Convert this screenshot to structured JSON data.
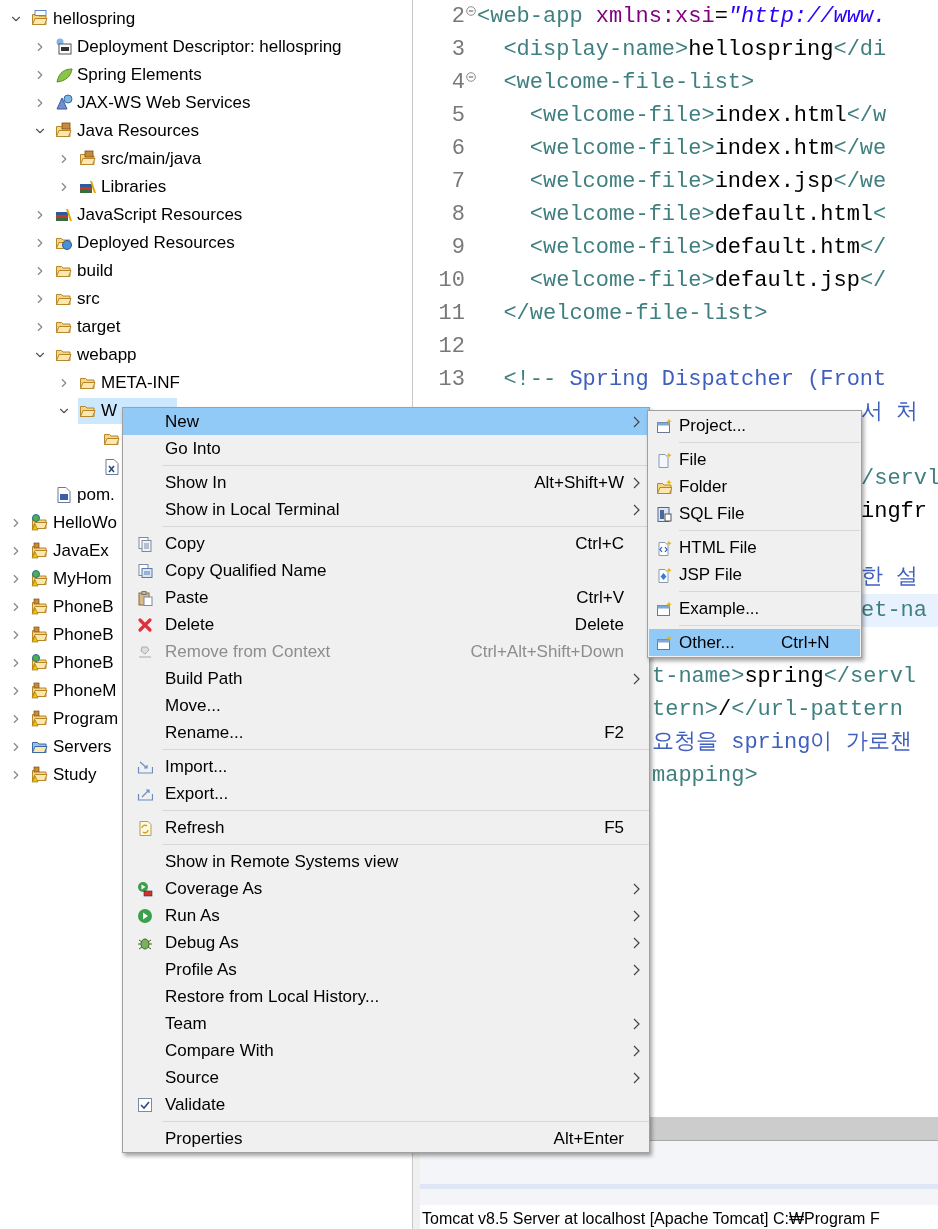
{
  "project_explorer": {
    "tree": [
      {
        "label": "hellospring",
        "kind": "maven-project",
        "expanded": true,
        "selected": false,
        "children": [
          {
            "label": "Deployment Descriptor: hellospring",
            "kind": "descriptor",
            "expanded": false,
            "selected": false
          },
          {
            "label": "Spring Elements",
            "kind": "leaf",
            "expanded": false,
            "selected": false
          },
          {
            "label": "JAX-WS Web Services",
            "kind": "webservice",
            "expanded": false,
            "selected": false
          },
          {
            "label": "Java Resources",
            "kind": "java-folder",
            "expanded": true,
            "selected": false,
            "children": [
              {
                "label": "src/main/java",
                "kind": "package-folder",
                "expanded": false,
                "selected": false
              },
              {
                "label": "Libraries",
                "kind": "books",
                "expanded": false,
                "selected": false
              }
            ]
          },
          {
            "label": "JavaScript Resources",
            "kind": "books",
            "expanded": false,
            "selected": false
          },
          {
            "label": "Deployed Resources",
            "kind": "globe-folder",
            "expanded": false,
            "selected": false
          },
          {
            "label": "build",
            "kind": "folder",
            "expanded": false,
            "selected": false
          },
          {
            "label": "src",
            "kind": "folder",
            "expanded": false,
            "selected": false
          },
          {
            "label": "target",
            "kind": "folder",
            "expanded": false,
            "selected": false
          },
          {
            "label": "webapp",
            "kind": "folder",
            "expanded": true,
            "selected": false,
            "children": [
              {
                "label": "META-INF",
                "kind": "folder",
                "expanded": false,
                "selected": false
              },
              {
                "label": "W",
                "kind": "folder",
                "expanded": true,
                "selected": true,
                "children": [
                  {
                    "kind": "folder",
                    "selected": false
                  },
                  {
                    "kind": "xml-file",
                    "selected": false
                  }
                ]
              }
            ]
          },
          {
            "label": "pom.",
            "kind": "maven-file",
            "selected": false
          }
        ]
      },
      {
        "label": "HelloWo",
        "kind": "globe-project",
        "expanded": false,
        "selected": false
      },
      {
        "label": "JavaEx",
        "kind": "project",
        "expanded": false,
        "selected": false
      },
      {
        "label": "MyHom",
        "kind": "globe-project",
        "expanded": false,
        "selected": false
      },
      {
        "label": "PhoneB",
        "kind": "project",
        "expanded": false,
        "selected": false
      },
      {
        "label": "PhoneB",
        "kind": "project",
        "expanded": false,
        "selected": false
      },
      {
        "label": "PhoneB",
        "kind": "globe-project",
        "expanded": false,
        "selected": false
      },
      {
        "label": "PhoneM",
        "kind": "project",
        "expanded": false,
        "selected": false
      },
      {
        "label": "Program",
        "kind": "project",
        "expanded": false,
        "selected": false
      },
      {
        "label": "Servers",
        "kind": "server-folder",
        "expanded": false,
        "selected": false
      },
      {
        "label": "Study",
        "kind": "project",
        "expanded": false,
        "selected": false
      }
    ]
  },
  "editor": {
    "lines": [
      {
        "kind": "full",
        "number": "2",
        "fold": true,
        "current": false,
        "segments": [
          {
            "kind": "tag",
            "text": "<web-app"
          },
          {
            "kind": "attr",
            "text": " xmlns:xsi"
          },
          {
            "kind": "text",
            "text": "="
          },
          {
            "kind": "value",
            "text": "\"http://www."
          }
        ]
      },
      {
        "kind": "full",
        "number": "3",
        "fold": false,
        "current": false,
        "segments": [
          {
            "kind": "tag",
            "text": "  <display-name>"
          },
          {
            "kind": "text",
            "text": "hellospring"
          },
          {
            "kind": "tag",
            "text": "</di"
          }
        ]
      },
      {
        "kind": "full",
        "number": "4",
        "fold": true,
        "current": false,
        "segments": [
          {
            "kind": "tag",
            "text": "  <welcome-file-list>"
          }
        ]
      },
      {
        "kind": "full",
        "number": "5",
        "fold": false,
        "current": false,
        "segments": [
          {
            "kind": "tag",
            "text": "    <welcome-file>"
          },
          {
            "kind": "text",
            "text": "index.html"
          },
          {
            "kind": "tag",
            "text": "</w"
          }
        ]
      },
      {
        "kind": "full",
        "number": "6",
        "fold": false,
        "current": false,
        "segments": [
          {
            "kind": "tag",
            "text": "    <welcome-file>"
          },
          {
            "kind": "text",
            "text": "index.htm"
          },
          {
            "kind": "tag",
            "text": "</we"
          }
        ]
      },
      {
        "kind": "full",
        "number": "7",
        "fold": false,
        "current": false,
        "segments": [
          {
            "kind": "tag",
            "text": "    <welcome-file>"
          },
          {
            "kind": "text",
            "text": "index.jsp"
          },
          {
            "kind": "tag",
            "text": "</we"
          }
        ]
      },
      {
        "kind": "full",
        "number": "8",
        "fold": false,
        "current": false,
        "segments": [
          {
            "kind": "tag",
            "text": "    <welcome-file>"
          },
          {
            "kind": "text",
            "text": "default.html"
          },
          {
            "kind": "tag",
            "text": "<"
          }
        ]
      },
      {
        "kind": "full",
        "number": "9",
        "fold": false,
        "current": false,
        "segments": [
          {
            "kind": "tag",
            "text": "    <welcome-file>"
          },
          {
            "kind": "text",
            "text": "default.htm"
          },
          {
            "kind": "tag",
            "text": "</"
          }
        ]
      },
      {
        "kind": "full",
        "number": "10",
        "fold": false,
        "current": false,
        "segments": [
          {
            "kind": "tag",
            "text": "    <welcome-file>"
          },
          {
            "kind": "text",
            "text": "default.jsp"
          },
          {
            "kind": "tag",
            "text": "</"
          }
        ]
      },
      {
        "kind": "full",
        "number": "11",
        "fold": false,
        "current": false,
        "segments": [
          {
            "kind": "tag",
            "text": "  </welcome-file-list>"
          }
        ]
      },
      {
        "kind": "full",
        "number": "12",
        "fold": false,
        "current": false
      },
      {
        "kind": "full",
        "number": "13",
        "fold": false,
        "current": false,
        "segments": [
          {
            "kind": "tag",
            "text": "  <!--"
          },
          {
            "kind": "comment",
            "text": " Spring Dispatcher (Front"
          }
        ]
      },
      {
        "kind": "after_submenu",
        "current": false,
        "segments": [
          {
            "kind": "comment",
            "text": "서 처"
          }
        ]
      },
      {
        "kind": "covered",
        "current": false
      },
      {
        "kind": "after_submenu",
        "current": false,
        "segments": [
          {
            "kind": "tag",
            "text": "/servl"
          }
        ]
      },
      {
        "kind": "after_submenu",
        "current": false,
        "segments": [
          {
            "kind": "text",
            "text": "ingfr"
          }
        ]
      },
      {
        "kind": "covered",
        "current": false
      },
      {
        "kind": "after_submenu",
        "current": false,
        "segments": [
          {
            "kind": "comment",
            "text": "한 설"
          }
        ]
      },
      {
        "kind": "after_submenu",
        "current": true,
        "segments": [
          {
            "kind": "tag",
            "text": "et-na"
          }
        ]
      },
      {
        "kind": "covered",
        "current": false
      },
      {
        "kind": "after_menu",
        "current": false,
        "segments": [
          {
            "kind": "tag",
            "text": "t-name>"
          },
          {
            "kind": "text",
            "text": "spring"
          },
          {
            "kind": "tag",
            "text": "</servl"
          }
        ]
      },
      {
        "kind": "after_menu",
        "current": false,
        "segments": [
          {
            "kind": "tag",
            "text": "tern>"
          },
          {
            "kind": "text",
            "text": "/"
          },
          {
            "kind": "tag",
            "text": "</url-pattern"
          }
        ]
      },
      {
        "kind": "after_menu",
        "current": false,
        "segments": [
          {
            "kind": "comment",
            "text": "요청을 spring이 가로챈"
          }
        ]
      },
      {
        "kind": "after_menu",
        "current": false,
        "segments": [
          {
            "kind": "tag",
            "text": "mapping>"
          }
        ]
      }
    ]
  },
  "console": {
    "text": "Tomcat v8.5 Server at localhost [Apache Tomcat] C:₩Program F"
  },
  "context_menu": {
    "items": [
      {
        "kind": "plain",
        "label": "New",
        "submenu": true,
        "selected": true,
        "disabled": false
      },
      {
        "kind": "plain",
        "label": "Go Into",
        "submenu": false,
        "selected": false,
        "disabled": false
      },
      {
        "kind": "separator"
      },
      {
        "kind": "plain",
        "label": "Show In",
        "shortcut": "Alt+Shift+W",
        "submenu": true,
        "selected": false,
        "disabled": false
      },
      {
        "kind": "plain",
        "label": "Show in Local Terminal",
        "submenu": true,
        "selected": false,
        "disabled": false
      },
      {
        "kind": "separator"
      },
      {
        "kind": "copy",
        "label": "Copy",
        "shortcut": "Ctrl+C",
        "submenu": false,
        "selected": false,
        "disabled": false
      },
      {
        "kind": "copy-name",
        "label": "Copy Qualified Name",
        "submenu": false,
        "selected": false,
        "disabled": false
      },
      {
        "kind": "paste",
        "label": "Paste",
        "shortcut": "Ctrl+V",
        "submenu": false,
        "selected": false,
        "disabled": false
      },
      {
        "kind": "delete",
        "label": "Delete",
        "shortcut": "Delete",
        "submenu": false,
        "selected": false,
        "disabled": false
      },
      {
        "kind": "remove",
        "label": "Remove from Context",
        "shortcut": "Ctrl+Alt+Shift+Down",
        "submenu": false,
        "selected": false,
        "disabled": true
      },
      {
        "kind": "plain",
        "label": "Build Path",
        "submenu": true,
        "selected": false,
        "disabled": false
      },
      {
        "kind": "plain",
        "label": "Move...",
        "submenu": false,
        "selected": false,
        "disabled": false
      },
      {
        "kind": "plain",
        "label": "Rename...",
        "shortcut": "F2",
        "submenu": false,
        "selected": false,
        "disabled": false
      },
      {
        "kind": "separator"
      },
      {
        "kind": "import",
        "label": "Import...",
        "submenu": false,
        "selected": false,
        "disabled": false
      },
      {
        "kind": "export",
        "label": "Export...",
        "submenu": false,
        "selected": false,
        "disabled": false
      },
      {
        "kind": "separator"
      },
      {
        "kind": "refresh",
        "label": "Refresh",
        "shortcut": "F5",
        "submenu": false,
        "selected": false,
        "disabled": false
      },
      {
        "kind": "separator"
      },
      {
        "kind": "plain",
        "label": "Show in Remote Systems view",
        "submenu": false,
        "selected": false,
        "disabled": false
      },
      {
        "kind": "coverage",
        "label": "Coverage As",
        "submenu": true,
        "selected": false,
        "disabled": false
      },
      {
        "kind": "run",
        "label": "Run As",
        "submenu": true,
        "selected": false,
        "disabled": false
      },
      {
        "kind": "debug",
        "label": "Debug As",
        "submenu": true,
        "selected": false,
        "disabled": false
      },
      {
        "kind": "plain",
        "label": "Profile As",
        "submenu": true,
        "selected": false,
        "disabled": false
      },
      {
        "kind": "plain",
        "label": "Restore from Local History...",
        "submenu": false,
        "selected": false,
        "disabled": false
      },
      {
        "kind": "plain",
        "label": "Team",
        "submenu": true,
        "selected": false,
        "disabled": false
      },
      {
        "kind": "plain",
        "label": "Compare With",
        "submenu": true,
        "selected": false,
        "disabled": false
      },
      {
        "kind": "plain",
        "label": "Source",
        "submenu": true,
        "selected": false,
        "disabled": false
      },
      {
        "kind": "checkbox",
        "label": "Validate",
        "checked": true,
        "submenu": false,
        "selected": false,
        "disabled": false
      },
      {
        "kind": "separator"
      },
      {
        "kind": "plain",
        "label": "Properties",
        "shortcut": "Alt+Enter",
        "submenu": false,
        "selected": false,
        "disabled": false
      }
    ]
  },
  "submenu": {
    "items": [
      {
        "kind": "new-project",
        "label": "Project...",
        "selected": false
      },
      {
        "kind": "separator"
      },
      {
        "kind": "new-file",
        "label": "File",
        "selected": false
      },
      {
        "kind": "new-folder",
        "label": "Folder",
        "selected": false
      },
      {
        "kind": "sql-file",
        "label": "SQL File",
        "selected": false
      },
      {
        "kind": "separator"
      },
      {
        "kind": "html-file",
        "label": "HTML File",
        "selected": false
      },
      {
        "kind": "jsp-file",
        "label": "JSP File",
        "selected": false
      },
      {
        "kind": "separator"
      },
      {
        "kind": "new-project",
        "label": "Example...",
        "selected": false
      },
      {
        "kind": "separator"
      },
      {
        "kind": "new-project",
        "label": "Other...",
        "shortcut": "Ctrl+N",
        "selected": true
      }
    ]
  }
}
